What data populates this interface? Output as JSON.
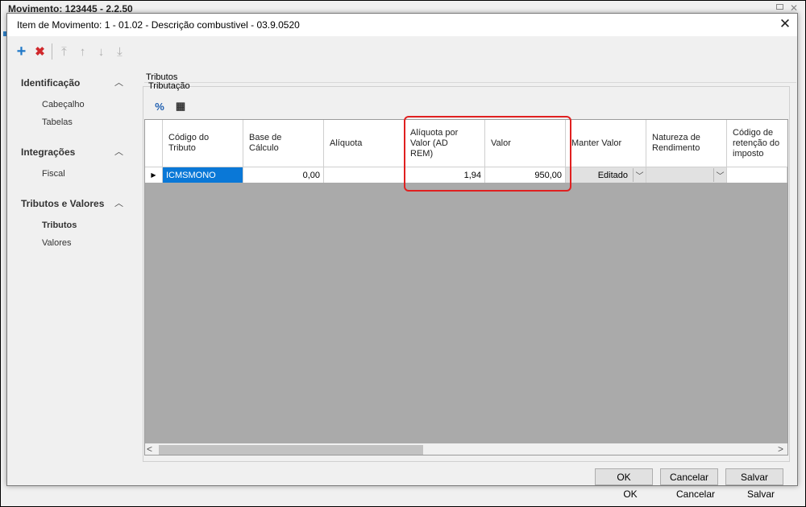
{
  "background_window": {
    "title": "Movimento: 123445 - 2.2.50",
    "footer": {
      "ok": "OK",
      "cancel": "Cancelar",
      "save": "Salvar"
    }
  },
  "dialog": {
    "title": "Item de Movimento: 1 - 01.02 - Descrição combustivel - 03.9.0520",
    "close": "✕",
    "toolbar": {
      "add_icon": "+",
      "delete_icon": "✖",
      "first_icon": "⤒",
      "up_icon": "↑",
      "down_icon": "↓",
      "last_icon": "⤓"
    },
    "nav": {
      "groups": [
        {
          "label": "Identificação",
          "chevron": "︿",
          "items": [
            "Cabeçalho",
            "Tabelas"
          ]
        },
        {
          "label": "Integrações",
          "chevron": "︿",
          "items": [
            "Fiscal"
          ]
        },
        {
          "label": "Tributos e Valores",
          "chevron": "︿",
          "items": [
            "Tributos",
            "Valores"
          ]
        }
      ]
    },
    "section_title": "Tributos",
    "group_title": "Tributação",
    "grid_tools": {
      "percent_icon": "%",
      "calculator_icon": "▦"
    },
    "grid": {
      "columns": [
        "Código do\nTributo",
        "Base de\nCálculo",
        "Alíquota",
        "Alíquota por\nValor (AD\nREM)",
        "Valor",
        "Manter Valor",
        "Natureza de\nRendimento",
        "Código de\nretenção do\nimposto"
      ],
      "row": {
        "indicator": "▶",
        "codigo": "ICMSMONO",
        "base": "0,00",
        "aliquota": "",
        "aliquota_ad_rem": "1,94",
        "valor": "950,00",
        "manter_valor": "Editado",
        "natureza": "",
        "codigo_retencao": ""
      },
      "scroll_left": "<",
      "scroll_right": ">"
    },
    "footer": {
      "ok": "OK",
      "cancel": "Cancelar",
      "save": "Salvar"
    },
    "colors": {
      "selection": "#0a78d7",
      "highlight": "#e02020",
      "add_icon": "#1f78c8",
      "delete_icon": "#d0282c"
    }
  }
}
